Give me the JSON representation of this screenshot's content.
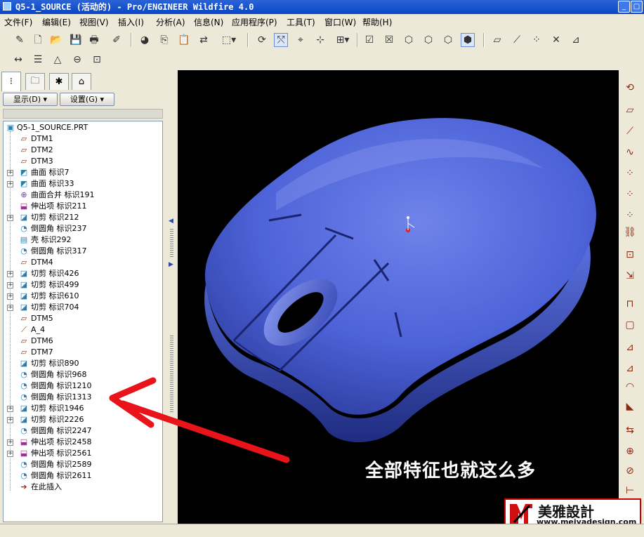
{
  "window": {
    "title": "Q5-1_SOURCE (活动的) - Pro/ENGINEER Wildfire 4.0",
    "min_glyph": "_",
    "max_glyph": "□"
  },
  "menu": [
    "文件(F)",
    "编辑(E)",
    "视图(V)",
    "插入(I)",
    "分析(A)",
    "信息(N)",
    "应用程序(P)",
    "工具(T)",
    "窗口(W)",
    "帮助(H)"
  ],
  "toolbar_icons": {
    "row1": [
      "edit-definition-icon",
      "new-file-icon",
      "open-folder-icon",
      "save-icon",
      "save-copy-icon",
      "edit-icon",
      "color-appearance-icon",
      "copy-icon",
      "paste-icon",
      "paste-special-icon",
      "select-box-icon",
      "regenerate-icon",
      "axis-display-icon",
      "point-display-icon",
      "csys-display-icon",
      "annotation-display-icon",
      "window-icon",
      "close-window-icon",
      "wireframe-icon",
      "hidden-line-icon",
      "no-hidden-icon",
      "shading-icon",
      "datum-plane-icon",
      "datum-axis-icon",
      "datum-point-icon",
      "datum-csys-icon",
      "datum-tag-icon"
    ],
    "row2": [
      "dimension-icon",
      "layer-icon",
      "model-tree-icon",
      "saved-view-icon",
      "appearance-icon"
    ]
  },
  "left_panel": {
    "tabs": [
      "model-tree-tab",
      "folder-browser-tab",
      "favorites-tab",
      "connections-tab"
    ],
    "display_button": "显示(D)",
    "settings_button": "设置(G)",
    "tree": {
      "root": "Q5-1_SOURCE.PRT",
      "items": [
        {
          "label": "DTM1",
          "icon": "datum-plane",
          "expand": false
        },
        {
          "label": "DTM2",
          "icon": "datum-plane",
          "expand": false
        },
        {
          "label": "DTM3",
          "icon": "datum-plane",
          "expand": false
        },
        {
          "label": "曲面 标识7",
          "icon": "surface",
          "expand": true
        },
        {
          "label": "曲面 标识33",
          "icon": "surface",
          "expand": true
        },
        {
          "label": "曲面合并 标识191",
          "icon": "merge",
          "expand": false
        },
        {
          "label": "伸出项 标识211",
          "icon": "protrusion",
          "expand": false
        },
        {
          "label": "切剪 标识212",
          "icon": "cut",
          "expand": true
        },
        {
          "label": "倒圆角 标识237",
          "icon": "round",
          "expand": false
        },
        {
          "label": "壳 标识292",
          "icon": "shell",
          "expand": false
        },
        {
          "label": "倒圆角 标识317",
          "icon": "round",
          "expand": false
        },
        {
          "label": "DTM4",
          "icon": "datum-plane",
          "expand": false
        },
        {
          "label": "切剪 标识426",
          "icon": "cut",
          "expand": true
        },
        {
          "label": "切剪 标识499",
          "icon": "cut",
          "expand": true
        },
        {
          "label": "切剪 标识610",
          "icon": "cut",
          "expand": true
        },
        {
          "label": "切剪 标识704",
          "icon": "cut",
          "expand": true
        },
        {
          "label": "DTM5",
          "icon": "datum-plane",
          "expand": false
        },
        {
          "label": "A_4",
          "icon": "axis",
          "expand": false
        },
        {
          "label": "DTM6",
          "icon": "datum-plane",
          "expand": false
        },
        {
          "label": "DTM7",
          "icon": "datum-plane",
          "expand": false
        },
        {
          "label": "切剪 标识890",
          "icon": "cut",
          "expand": false
        },
        {
          "label": "倒圆角 标识968",
          "icon": "round",
          "expand": false
        },
        {
          "label": "倒圆角 标识1210",
          "icon": "round",
          "expand": false
        },
        {
          "label": "倒圆角 标识1313",
          "icon": "round",
          "expand": false
        },
        {
          "label": "切剪 标识1946",
          "icon": "cut",
          "expand": true
        },
        {
          "label": "切剪 标识2226",
          "icon": "cut",
          "expand": true
        },
        {
          "label": "倒圆角 标识2247",
          "icon": "round",
          "expand": false
        },
        {
          "label": "伸出项 标识2458",
          "icon": "protrusion",
          "expand": true
        },
        {
          "label": "伸出项 标识2561",
          "icon": "protrusion",
          "expand": true
        },
        {
          "label": "倒圆角 标识2589",
          "icon": "round",
          "expand": false
        },
        {
          "label": "倒圆角 标识2611",
          "icon": "round",
          "expand": false
        },
        {
          "label": "在此插入",
          "icon": "insert-here",
          "expand": false
        }
      ]
    }
  },
  "viewport": {
    "background": "#000000",
    "model_color": "#4d63d8",
    "annotation_caption": "全部特征也就这么多",
    "arrow_color": "#e8141a"
  },
  "right_toolbar_icons": [
    "spin-center-icon",
    "datum-plane-tool-icon",
    "datum-axis-tool-icon",
    "sketched-curve-icon",
    "datum-point-tool-icon",
    "offset-point-icon",
    "field-point-icon",
    "analysis-feature-icon",
    "sketch-tool-icon",
    "intent-icon",
    "hole-icon",
    "shell-icon",
    "rib-icon",
    "draft-icon",
    "round-tool-icon",
    "chamfer-icon",
    "mirror-icon",
    "merge-icon",
    "trim-icon",
    "extend-icon"
  ],
  "logo": {
    "name": "美雅設計",
    "url": "www.meiyadesign.com"
  },
  "status": {
    "text": ""
  }
}
